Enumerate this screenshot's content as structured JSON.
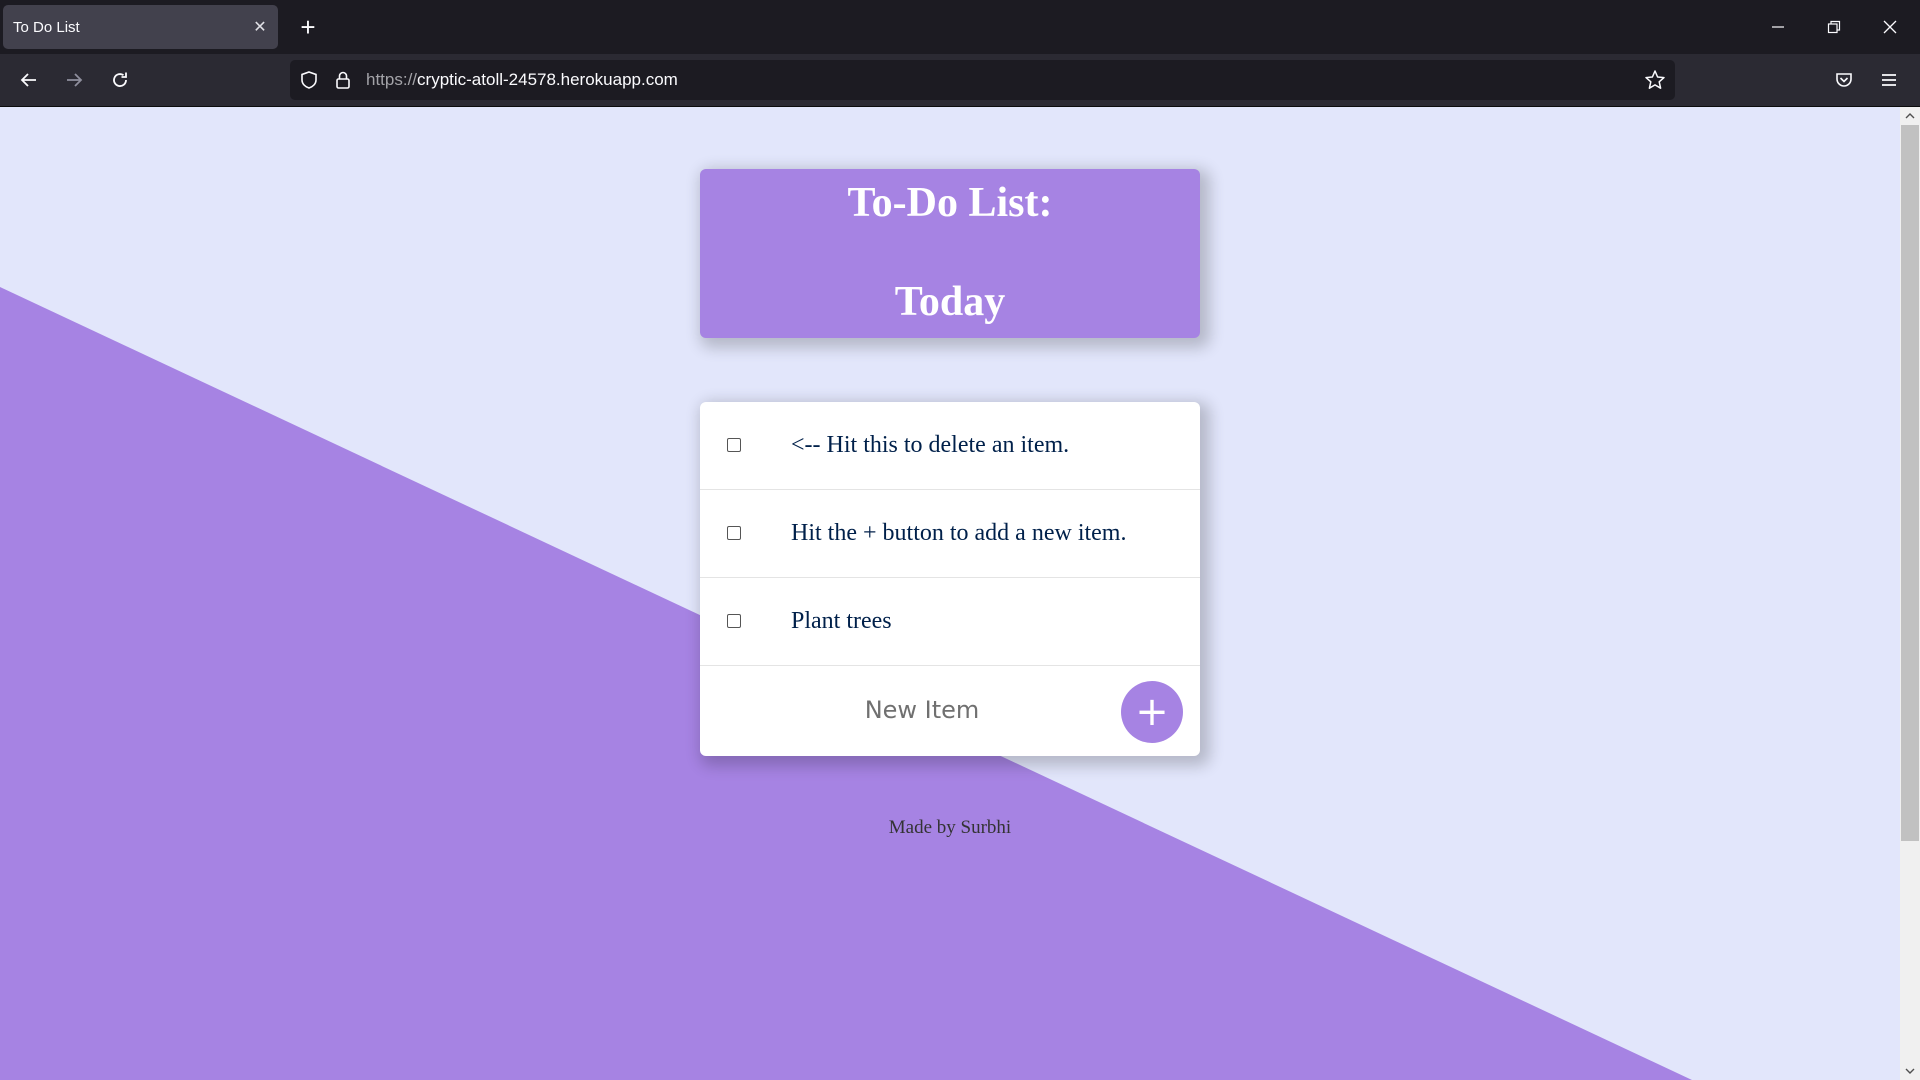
{
  "browser": {
    "tab_title": "To Do List",
    "tab_close": "✕",
    "new_tab": "+",
    "url_scheme": "https://",
    "url_host": "cryptic-atoll-24578.herokuapp.com"
  },
  "page": {
    "heading_line1": "To-Do List:",
    "heading_line2": "Today",
    "items": [
      {
        "text": "<-- Hit this to delete an item.",
        "checked": false
      },
      {
        "text": "Hit the + button to add a new item.",
        "checked": false
      },
      {
        "text": "Plant trees",
        "checked": false
      }
    ],
    "new_item_placeholder": "New Item",
    "add_button_label": "+",
    "footer": "Made by Surbhi"
  },
  "colors": {
    "accent": "#a683e3",
    "background": "#e2e6fb",
    "item_text": "#00204a"
  }
}
